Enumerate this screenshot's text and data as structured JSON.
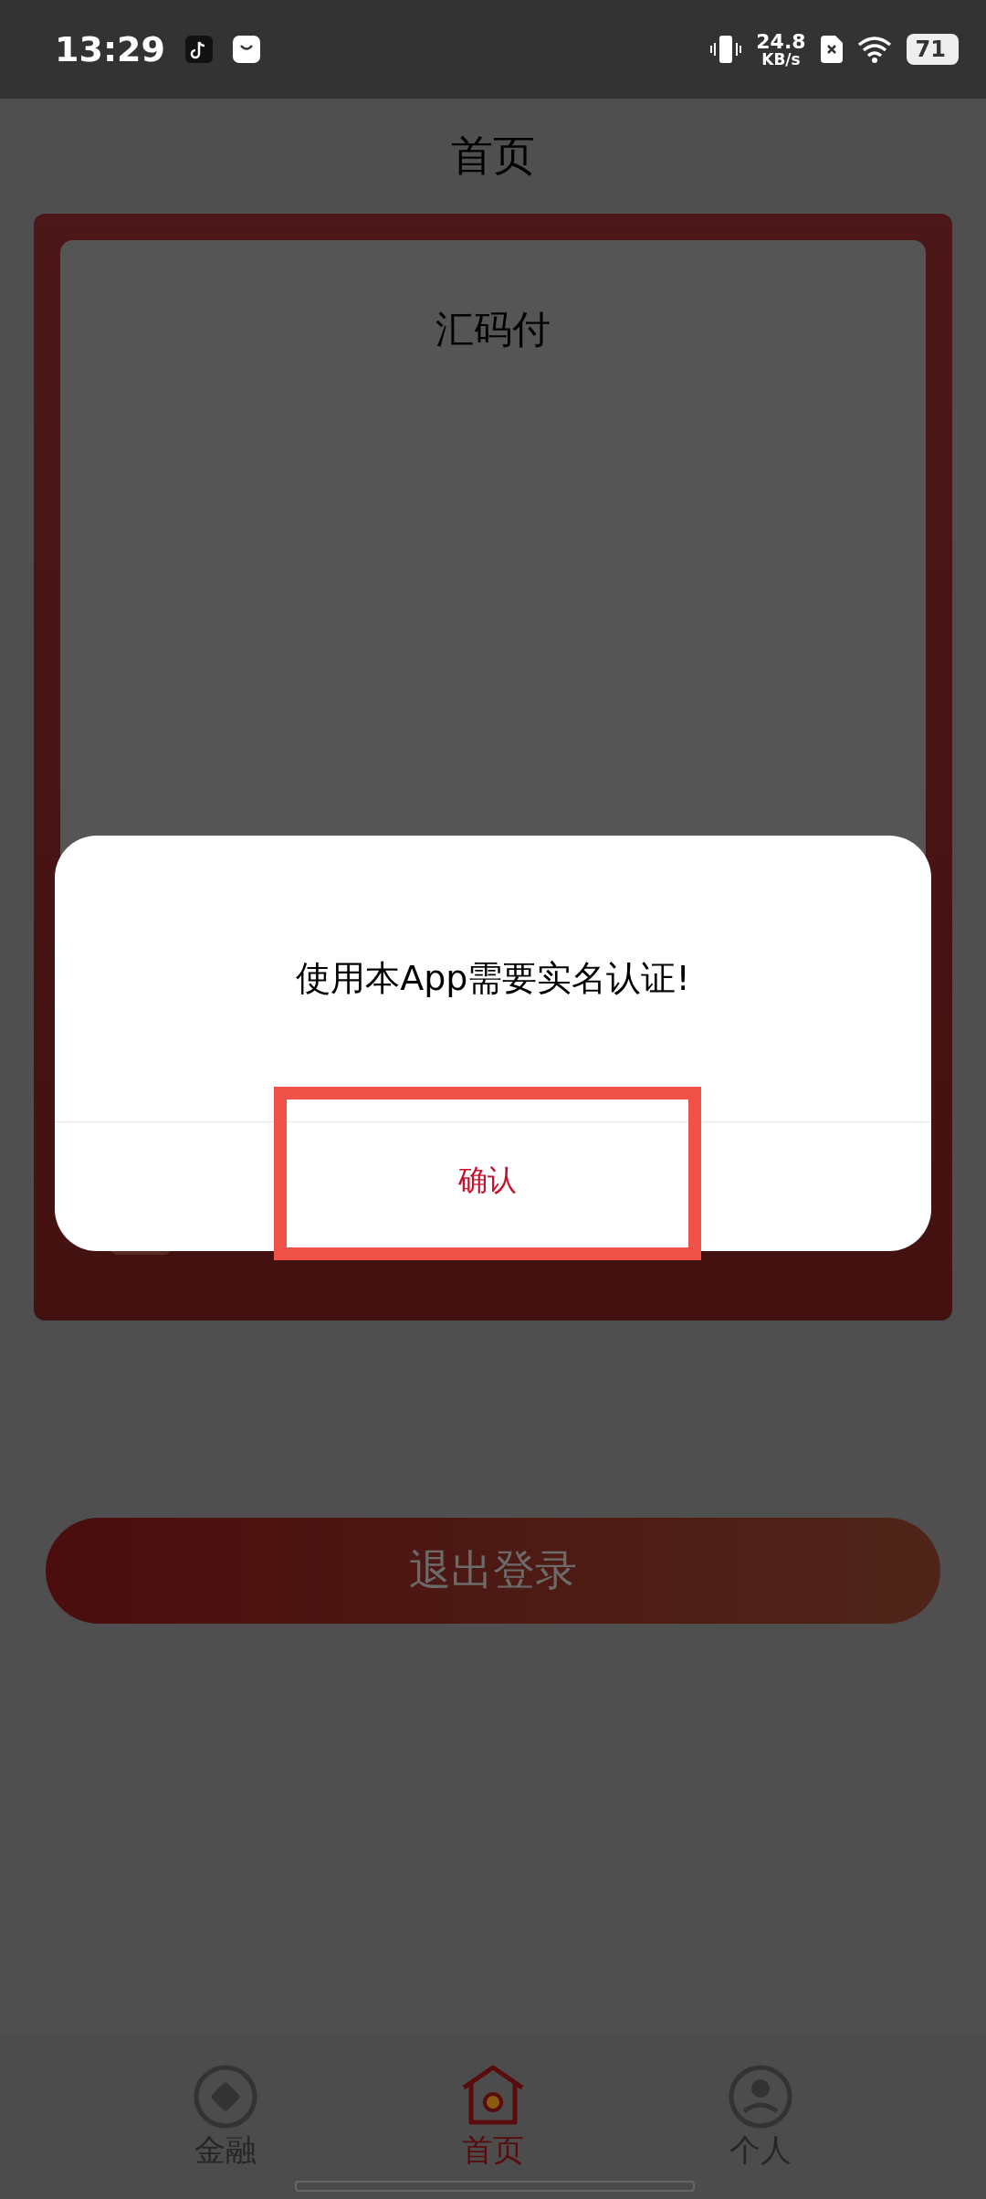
{
  "status_bar": {
    "time": "13:29",
    "speed": "24.8",
    "speed_unit": "KB/s",
    "battery": "71"
  },
  "header": {
    "title": "首页"
  },
  "card": {
    "title": "汇码付"
  },
  "dialog": {
    "message": "使用本App需要实名认证!",
    "confirm": "确认"
  },
  "logout_button": "退出登录",
  "tabs": [
    {
      "label": "金融",
      "kind": "finance",
      "selected": false
    },
    {
      "label": "首页",
      "kind": "home",
      "selected": true
    },
    {
      "label": "个人",
      "kind": "profile",
      "selected": false
    }
  ]
}
